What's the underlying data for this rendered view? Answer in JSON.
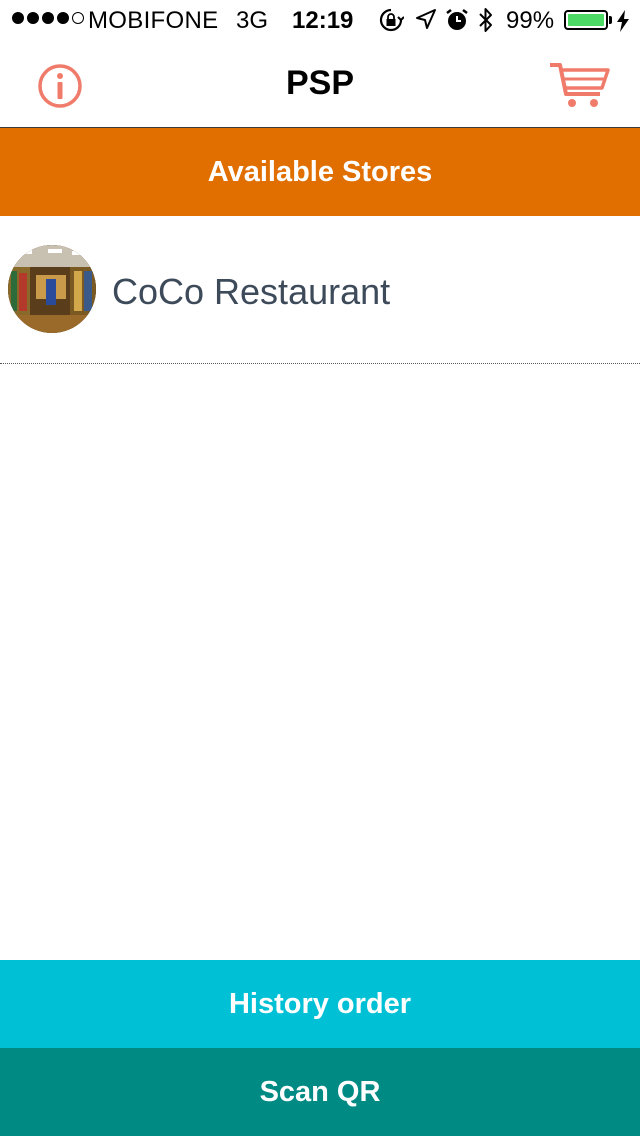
{
  "status_bar": {
    "signal_bars_filled": 4,
    "signal_bars_total": 5,
    "carrier": "MOBIFONE",
    "network": "3G",
    "time": "12:19",
    "icons": [
      "rotation-lock-icon",
      "location-arrow-icon",
      "alarm-icon",
      "bluetooth-icon"
    ],
    "battery_percent": "99%",
    "battery_level": 0.99,
    "battery_color": "#4cd964",
    "charging": true
  },
  "nav": {
    "title": "PSP",
    "left_icon": "info-icon",
    "right_icon": "cart-icon",
    "icon_color": "#f07b6a"
  },
  "section": {
    "title": "Available Stores",
    "color": "#e06f00"
  },
  "stores": [
    {
      "name": "CoCo Restaurant"
    }
  ],
  "actions": {
    "history_label": "History order",
    "history_color": "#00c0d6",
    "scan_label": "Scan QR",
    "scan_color": "#008a84"
  }
}
